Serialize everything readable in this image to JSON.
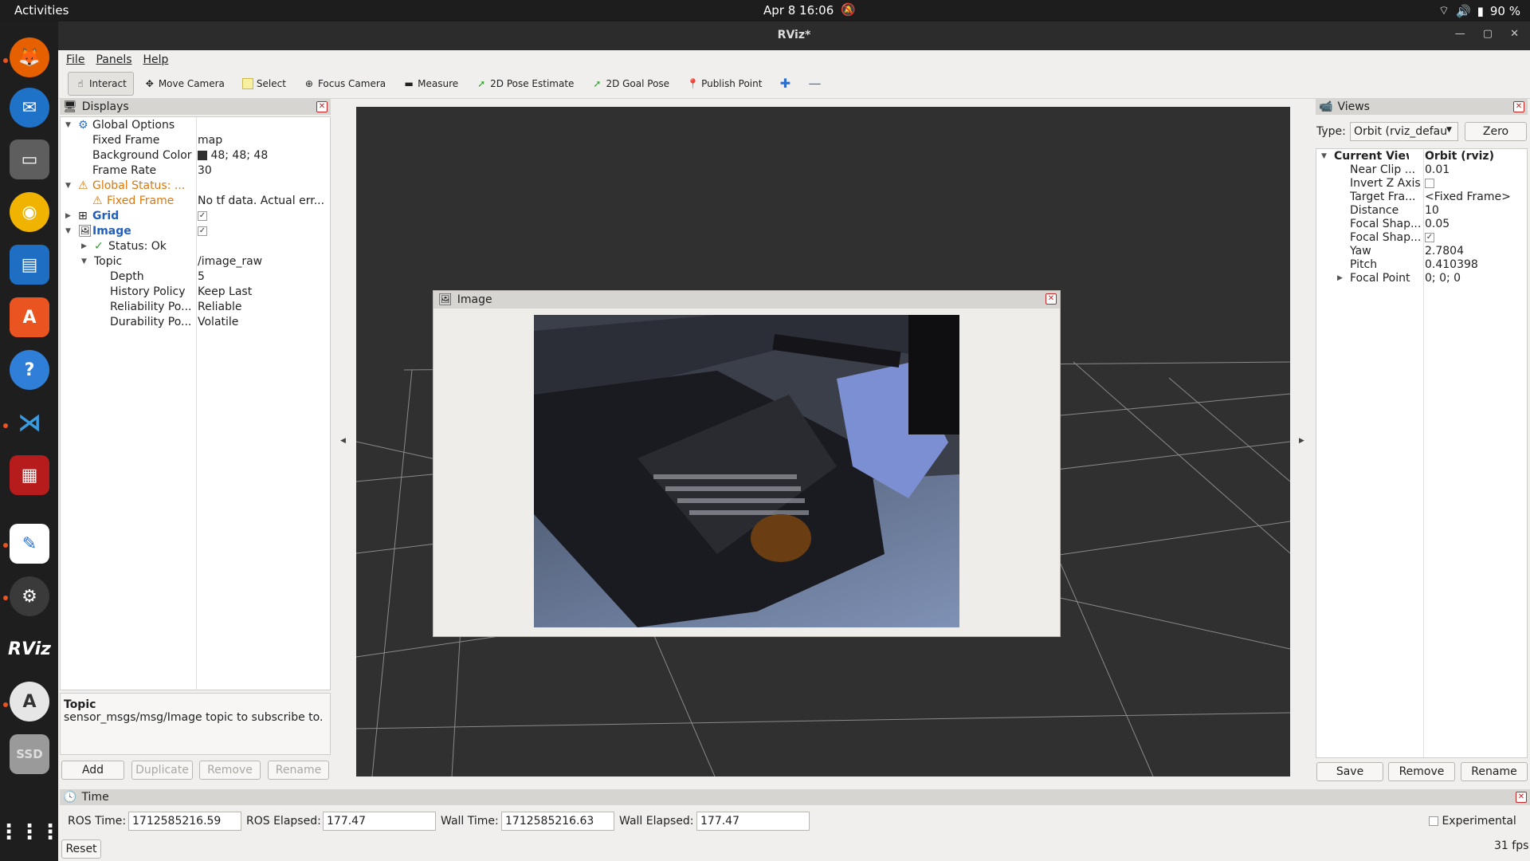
{
  "topbar": {
    "activities": "Activities",
    "clock": "Apr 8  16:06",
    "battery": "90 %"
  },
  "window": {
    "title": "RViz*"
  },
  "menu": [
    "File",
    "Panels",
    "Help"
  ],
  "toolbar": {
    "interact": "Interact",
    "move_camera": "Move Camera",
    "select": "Select",
    "focus_camera": "Focus Camera",
    "measure": "Measure",
    "pose_estimate": "2D Pose Estimate",
    "goal_pose": "2D Goal Pose",
    "publish_point": "Publish Point"
  },
  "displays": {
    "title": "Displays",
    "global_options": "Global Options",
    "fixed_frame_label": "Fixed Frame",
    "fixed_frame_value": "map",
    "bg_color_label": "Background Color",
    "bg_color_value": "48; 48; 48",
    "frame_rate_label": "Frame Rate",
    "frame_rate_value": "30",
    "global_status": "Global Status: ...",
    "fixed_frame_err_label": "Fixed Frame",
    "fixed_frame_err_value": "No tf data.  Actual err...",
    "grid": "Grid",
    "image": "Image",
    "status_ok": "Status: Ok",
    "topic_label": "Topic",
    "topic_value": "/image_raw",
    "depth_label": "Depth",
    "depth_value": "5",
    "history_label": "History Policy",
    "history_value": "Keep Last",
    "reliability_label": "Reliability Po...",
    "reliability_value": "Reliable",
    "durability_label": "Durability Po...",
    "durability_value": "Volatile"
  },
  "description": {
    "title": "Topic",
    "text": "sensor_msgs/msg/Image topic to subscribe to."
  },
  "display_buttons": {
    "add": "Add",
    "duplicate": "Duplicate",
    "remove": "Remove",
    "rename": "Rename"
  },
  "image_window": {
    "title": "Image"
  },
  "views": {
    "title": "Views",
    "type_label": "Type:",
    "type_value": "Orbit (rviz_defau",
    "zero": "Zero",
    "current_view": "Current View",
    "current_view_value": "Orbit (rviz)",
    "near_clip_label": "Near Clip ...",
    "near_clip_value": "0.01",
    "invert_z_label": "Invert Z Axis",
    "target_frame_label": "Target Fra...",
    "target_frame_value": "<Fixed Frame>",
    "distance_label": "Distance",
    "distance_value": "10",
    "focal_shape1_label": "Focal Shap...",
    "focal_shape1_value": "0.05",
    "focal_shape2_label": "Focal Shap...",
    "yaw_label": "Yaw",
    "yaw_value": "2.7804",
    "pitch_label": "Pitch",
    "pitch_value": "0.410398",
    "focal_point_label": "Focal Point",
    "focal_point_value": "0; 0; 0",
    "save": "Save",
    "remove": "Remove",
    "rename": "Rename"
  },
  "time": {
    "title": "Time",
    "ros_time_label": "ROS Time:",
    "ros_time_value": "1712585216.59",
    "ros_elapsed_label": "ROS Elapsed:",
    "ros_elapsed_value": "177.47",
    "wall_time_label": "Wall Time:",
    "wall_time_value": "1712585216.63",
    "wall_elapsed_label": "Wall Elapsed:",
    "wall_elapsed_value": "177.47",
    "experimental": "Experimental",
    "reset": "Reset",
    "fps": "31 fps"
  },
  "dock": {
    "rviz_label": "RViz",
    "ssd_label": "SSD"
  },
  "colors": {
    "accent": "#e95420",
    "viewport_bg": "#303030",
    "link_blue": "#1f5fbf",
    "warn_orange": "#d9780f"
  }
}
